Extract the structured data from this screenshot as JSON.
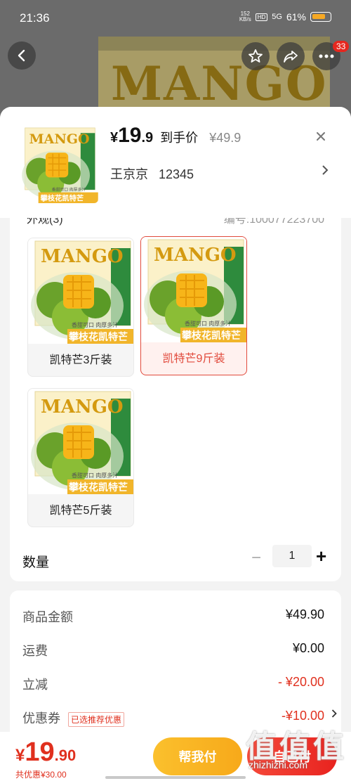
{
  "status_bar": {
    "time": "21:36",
    "net_speed_value": "152",
    "net_speed_unit": "KB/s",
    "hd": "HD",
    "signal": "5G",
    "battery": "61%"
  },
  "background_page": {
    "banner_text": "MANGO",
    "more_badge": "33"
  },
  "icons": {
    "back": "back-arrow-icon",
    "favorite": "star-icon",
    "share": "share-icon",
    "more": "more-icon"
  },
  "product_art": {
    "brand": "MANGO",
    "ribbon": "攀枝花凯特芒",
    "slogan": "香甜可口 肉厚多汁"
  },
  "header": {
    "currency": "¥",
    "price_int": "19",
    "price_dec": ".9",
    "price_tag": "到手价",
    "original_price": "¥49.9",
    "address_name": "王京京",
    "address_phone": "12345"
  },
  "spec": {
    "title_partial": "外观(3)",
    "id_partial": "编号:100077223700",
    "options": [
      {
        "label": "凯特芒3斤装",
        "selected": false
      },
      {
        "label": "凯特芒9斤装",
        "selected": true
      },
      {
        "label": "凯特芒5斤装",
        "selected": false
      }
    ]
  },
  "quantity": {
    "label": "数量",
    "minus": "−",
    "value": "1",
    "plus": "+"
  },
  "fees": {
    "amount_label": "商品金额",
    "amount_value": "¥49.90",
    "shipping_label": "运费",
    "shipping_value": "¥0.00",
    "discount_label": "立减",
    "discount_value": "- ¥20.00",
    "coupon_label": "优惠券",
    "coupon_tag": "已选推荐优惠",
    "coupon_value": "-¥10.00"
  },
  "bottom_bar": {
    "currency": "¥",
    "total_int": "19",
    "total_dec": ".90",
    "saved": "共优惠¥30.00",
    "help_pay": "帮我付",
    "self_pay": "自己付"
  },
  "watermark": {
    "big": "值值值",
    "site": "zhizhizhi.com"
  },
  "colors": {
    "accent_red": "#e0301e",
    "help_yellow": "#f7a91a",
    "selected_border": "#e14a3c"
  }
}
